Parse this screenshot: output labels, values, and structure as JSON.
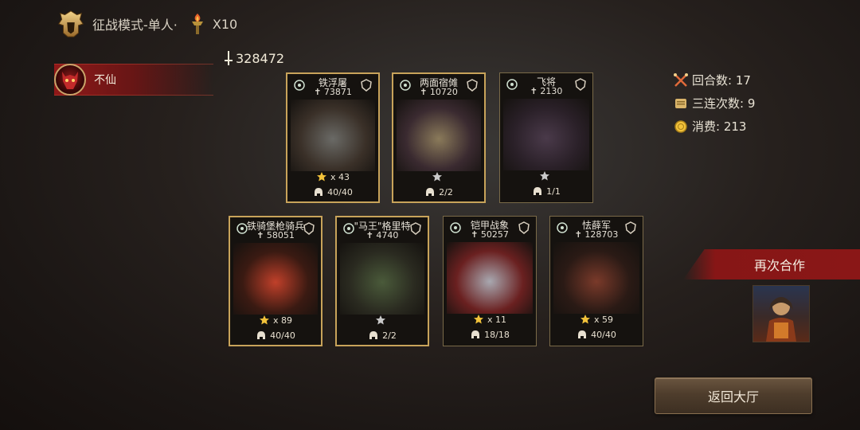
{
  "header": {
    "mode_label": "征战模式-单人·",
    "ticket_count": "X10"
  },
  "total_power": "328472",
  "player": {
    "name": "不仙"
  },
  "cards": [
    {
      "name": "铁浮屠",
      "power": "73871",
      "stars": "x 43",
      "troops": "40/40",
      "gold_frame": true,
      "has_star_count": true,
      "star_color": "#f2c23a"
    },
    {
      "name": "两面宿傩",
      "power": "10720",
      "stars": "",
      "troops": "2/2",
      "gold_frame": true,
      "has_star_count": false,
      "star_color": "#c9c9c9"
    },
    {
      "name": "飞将",
      "power": "2130",
      "stars": "",
      "troops": "1/1",
      "gold_frame": false,
      "has_star_count": false,
      "star_color": "#c9c9c9"
    },
    {
      "name": "铁骑堡枪骑兵",
      "power": "58051",
      "stars": "x 89",
      "troops": "40/40",
      "gold_frame": true,
      "has_star_count": true,
      "star_color": "#f2c23a"
    },
    {
      "name": "\"马王\"格里特",
      "power": "4740",
      "stars": "",
      "troops": "2/2",
      "gold_frame": true,
      "has_star_count": false,
      "star_color": "#c9c9c9"
    },
    {
      "name": "铠甲战象",
      "power": "50257",
      "stars": "x 11",
      "troops": "18/18",
      "gold_frame": false,
      "has_star_count": true,
      "star_color": "#f2c23a"
    },
    {
      "name": "怯薛军",
      "power": "128703",
      "stars": "x 59",
      "troops": "40/40",
      "gold_frame": false,
      "has_star_count": true,
      "star_color": "#f2c23a"
    }
  ],
  "stats": {
    "rounds": "回合数: 17",
    "triple_combo": "三连次数: 9",
    "cost": "消费: 213"
  },
  "again_label": "再次合作",
  "return_label": "返回大厅",
  "colors": {
    "gold": "#c8a35a",
    "banner_red": "#8a1717",
    "star_gold": "#f2c23a"
  },
  "icons": {
    "mode": "spartan-helmet-icon",
    "ticket": "torch-icon",
    "power": "sword-icon",
    "rounds": "crossed-swords-icon",
    "combo": "scroll-icon",
    "cost": "coin-icon",
    "troops": "helmet-icon",
    "stars": "star-icon"
  }
}
